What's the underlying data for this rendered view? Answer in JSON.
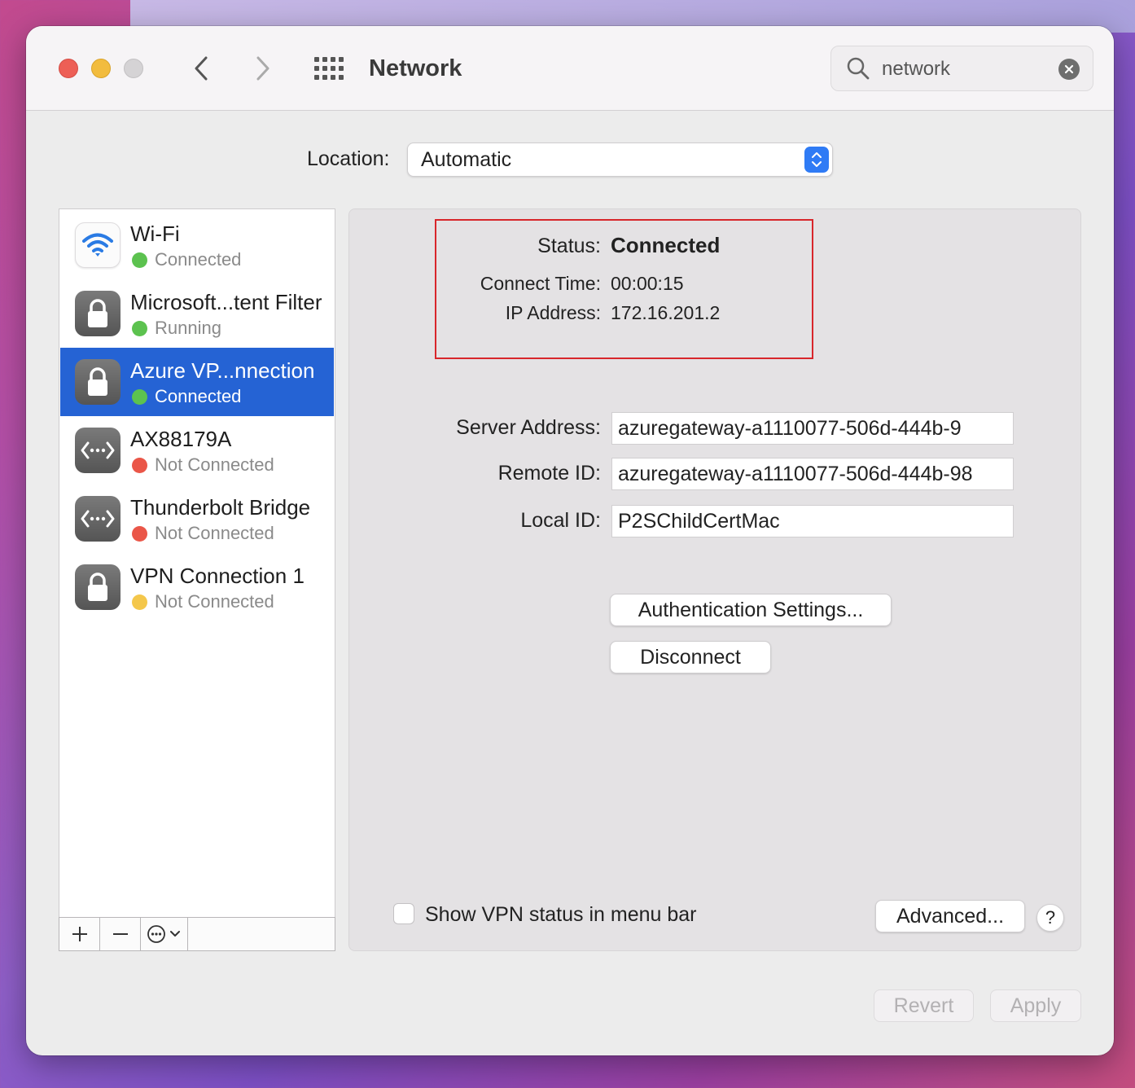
{
  "window": {
    "title": "Network",
    "search": {
      "value": "network",
      "placeholder": "Search"
    }
  },
  "location": {
    "label": "Location:",
    "value": "Automatic"
  },
  "services": [
    {
      "name": "Wi-Fi",
      "status": "Connected",
      "status_color": "#5cc24f",
      "icon": "wifi-icon"
    },
    {
      "name": "Microsoft...tent Filter",
      "status": "Running",
      "status_color": "#5cc24f",
      "icon": "lock-icon"
    },
    {
      "name": "Azure VP...nnection",
      "status": "Connected",
      "status_color": "#5cc24f",
      "icon": "lock-icon",
      "selected": true
    },
    {
      "name": "AX88179A",
      "status": "Not Connected",
      "status_color": "#ea5648",
      "icon": "ethernet-icon"
    },
    {
      "name": "Thunderbolt Bridge",
      "status": "Not Connected",
      "status_color": "#ea5648",
      "icon": "ethernet-icon"
    },
    {
      "name": "VPN Connection 1",
      "status": "Not Connected",
      "status_color": "#f4c74b",
      "icon": "lock-icon"
    }
  ],
  "detail": {
    "status_label": "Status:",
    "status_value": "Connected",
    "connect_time_label": "Connect Time:",
    "connect_time_value": "00:00:15",
    "ip_label": "IP Address:",
    "ip_value": "172.16.201.2",
    "server_address_label": "Server Address:",
    "server_address_value": "azuregateway-a1110077-506d-444b-9",
    "remote_id_label": "Remote ID:",
    "remote_id_value": "azuregateway-a1110077-506d-444b-98",
    "local_id_label": "Local ID:",
    "local_id_value": "P2SChildCertMac",
    "auth_settings_button": "Authentication Settings...",
    "disconnect_button": "Disconnect",
    "show_vpn_status_label": "Show VPN status in menu bar",
    "show_vpn_status_checked": false,
    "advanced_button": "Advanced...",
    "help_button": "?"
  },
  "footer": {
    "revert_button": "Revert",
    "apply_button": "Apply"
  },
  "colors": {
    "accent": "#2f7bf5",
    "selection": "#2563d4",
    "highlight_box": "#d8262b"
  }
}
